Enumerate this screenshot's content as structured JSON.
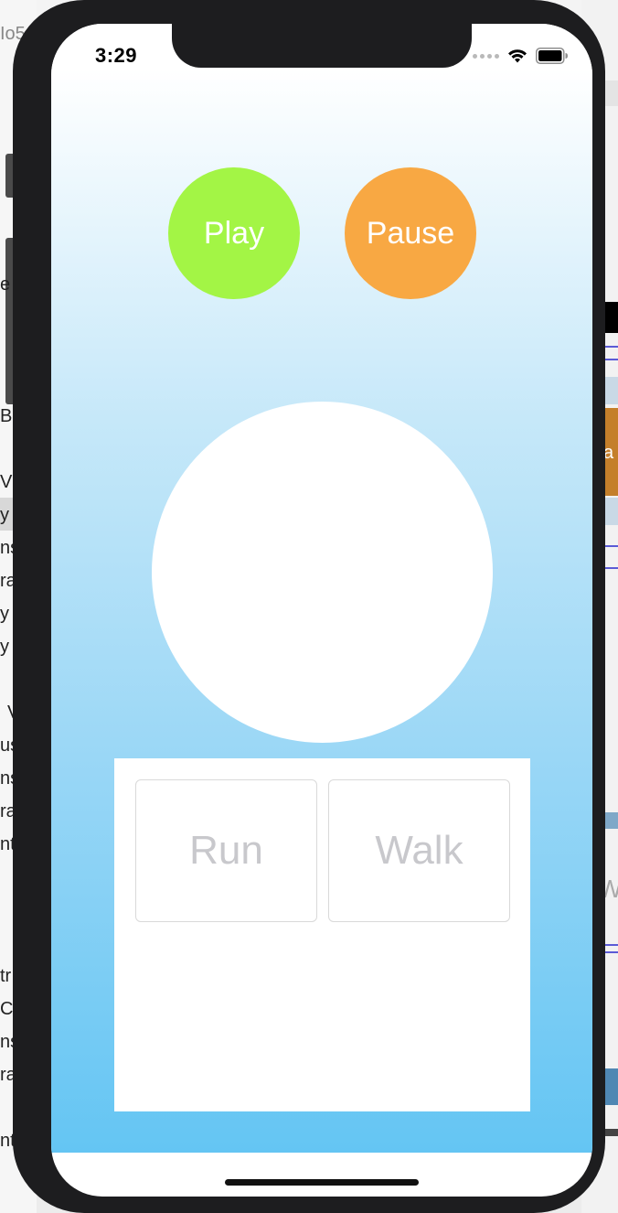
{
  "status_bar": {
    "time": "3:29"
  },
  "controls": {
    "play_label": "Play",
    "pause_label": "Pause",
    "run_label": "Run",
    "walk_label": "Walk"
  },
  "background_fragments": {
    "left": [
      "Io5",
      "e",
      "Bu",
      "Vie",
      "y",
      "ns",
      "ra",
      "y",
      "y",
      "V",
      "us",
      "ns",
      "ra",
      "nt",
      "tr",
      "Co",
      "ns",
      "ra",
      "nt"
    ],
    "right": [
      "a",
      "W"
    ]
  },
  "colors": {
    "play": "#a3f545",
    "pause": "#f8a843",
    "gradient_bottom": "#64c5f3",
    "tile_text": "#c8c8cc"
  }
}
